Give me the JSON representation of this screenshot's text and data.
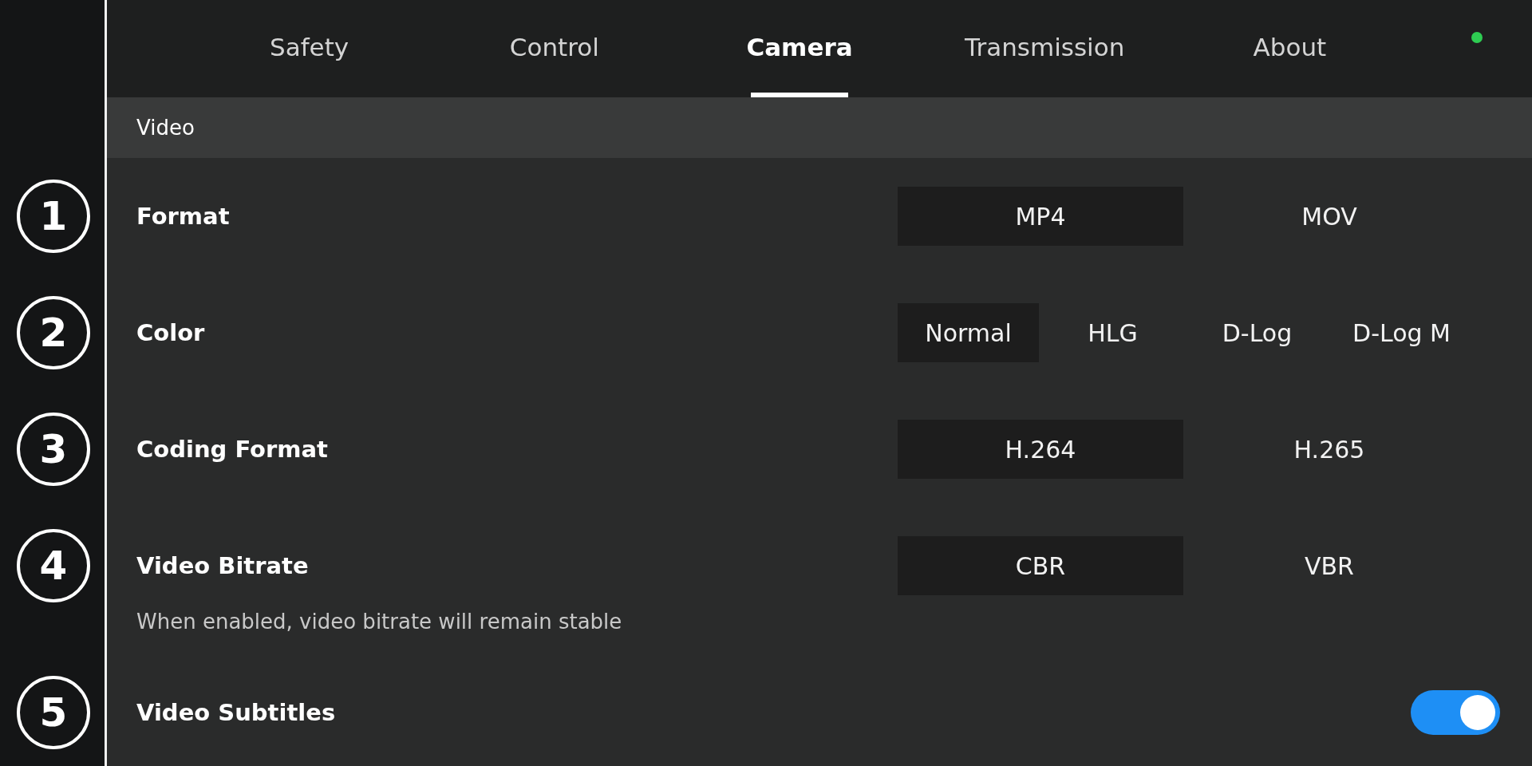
{
  "tabs": [
    {
      "label": "Safety",
      "selected": false
    },
    {
      "label": "Control",
      "selected": false
    },
    {
      "label": "Camera",
      "selected": true
    },
    {
      "label": "Transmission",
      "selected": false
    },
    {
      "label": "About",
      "selected": false
    }
  ],
  "section": {
    "title": "Video"
  },
  "settings": [
    {
      "marker": "1",
      "label": "Format",
      "kind": "segmented",
      "options": [
        {
          "label": "MP4",
          "selected": true
        },
        {
          "label": "MOV",
          "selected": false
        }
      ]
    },
    {
      "marker": "2",
      "label": "Color",
      "kind": "segmented",
      "options": [
        {
          "label": "Normal",
          "selected": true
        },
        {
          "label": "HLG",
          "selected": false
        },
        {
          "label": "D-Log",
          "selected": false
        },
        {
          "label": "D-Log M",
          "selected": false
        }
      ]
    },
    {
      "marker": "3",
      "label": "Coding Format",
      "kind": "segmented",
      "options": [
        {
          "label": "H.264",
          "selected": true
        },
        {
          "label": "H.265",
          "selected": false
        }
      ]
    },
    {
      "marker": "4",
      "label": "Video Bitrate",
      "kind": "segmented",
      "description": "When enabled, video bitrate will remain stable",
      "options": [
        {
          "label": "CBR",
          "selected": true
        },
        {
          "label": "VBR",
          "selected": false
        }
      ]
    },
    {
      "marker": "5",
      "label": "Video Subtitles",
      "kind": "toggle",
      "on": true
    }
  ]
}
